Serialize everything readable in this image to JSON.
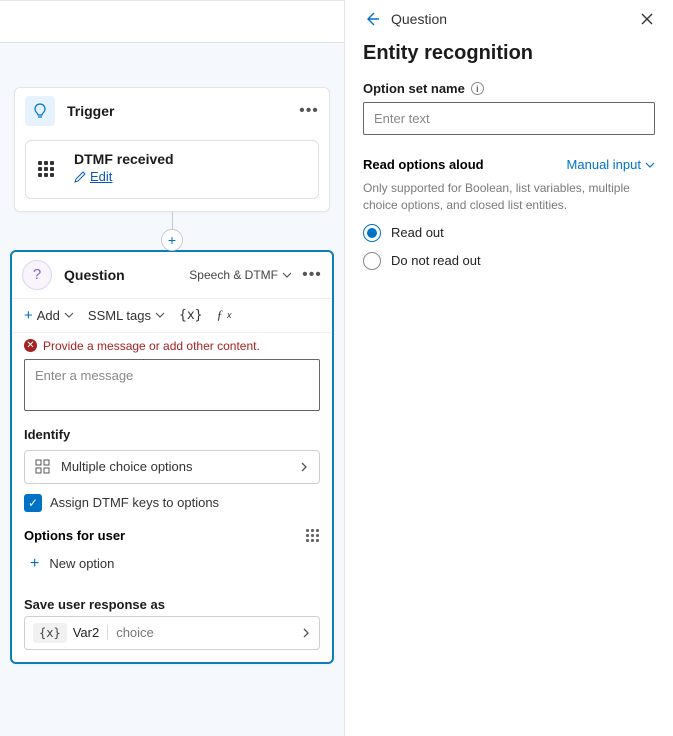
{
  "trigger": {
    "title": "Trigger",
    "event": "DTMF received",
    "edit": "Edit"
  },
  "question": {
    "title": "Question",
    "mode": "Speech & DTMF",
    "toolbar": {
      "add": "Add",
      "ssml": "SSML tags",
      "var": "{x}",
      "fx": "fx"
    },
    "error": "Provide a message or add other content.",
    "msg_placeholder": "Enter a message",
    "identify_label": "Identify",
    "identify_value": "Multiple choice options",
    "assign_label": "Assign DTMF keys to options",
    "options_label": "Options for user",
    "new_option": "New option",
    "save_label": "Save user response as",
    "var_name": "Var2",
    "var_type": "choice"
  },
  "panel": {
    "crumb": "Question",
    "title": "Entity recognition",
    "option_set_label": "Option set name",
    "option_set_placeholder": "Enter text",
    "read_label": "Read options aloud",
    "manual": "Manual input",
    "help": "Only supported for Boolean, list variables, multiple choice options, and closed list entities.",
    "radio1": "Read out",
    "radio2": "Do not read out"
  }
}
